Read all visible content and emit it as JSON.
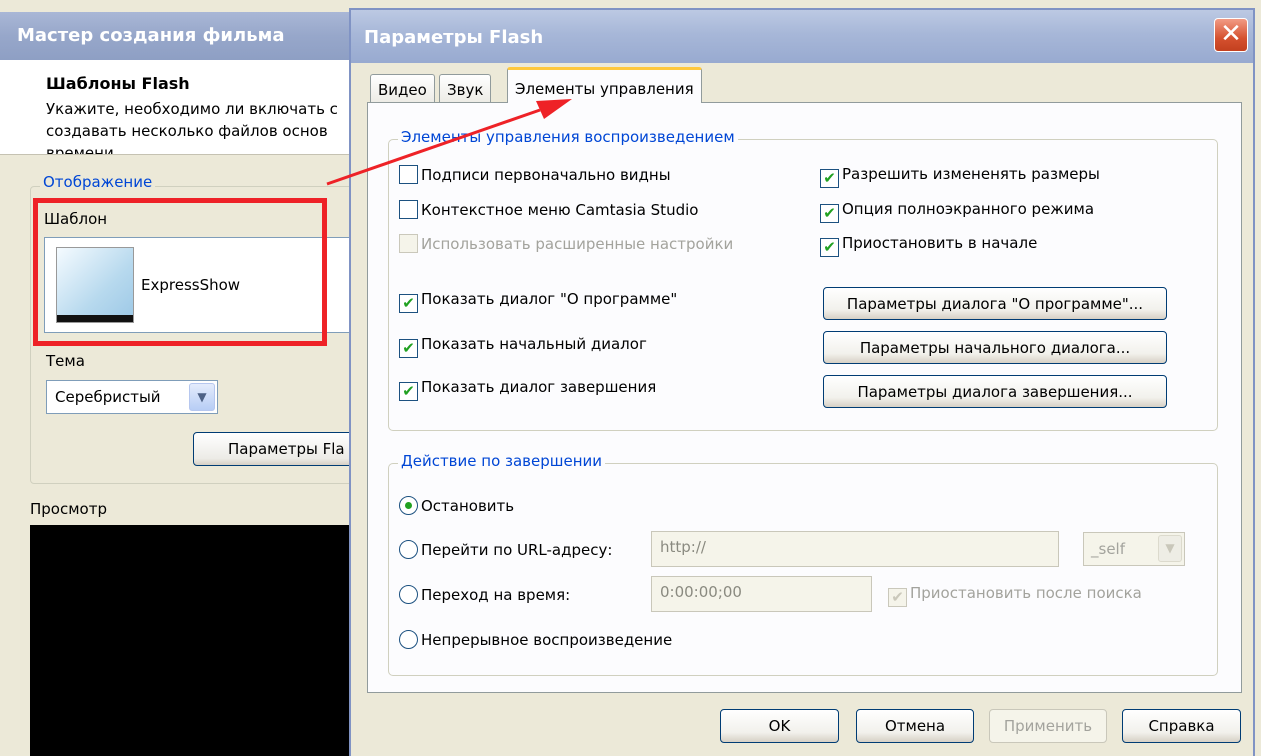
{
  "wizard": {
    "title": "Мастер создания фильма",
    "header_title": "Шаблоны Flash",
    "header_line1": "Укажите, необходимо ли включать с",
    "header_line2": "создавать несколько файлов основ",
    "header_line3": "времени.",
    "group_label": "Отображение",
    "template_label": "Шаблон",
    "template_name": "ExpressShow",
    "theme_label": "Тема",
    "theme_value": "Серебристый",
    "flash_params_button": "Параметры Fla",
    "preview_label": "Просмотр"
  },
  "dialog": {
    "title": "Параметры Flash",
    "close_glyph": "✕",
    "tabs": [
      {
        "label": "Видео",
        "active": false
      },
      {
        "label": "Звук",
        "active": false
      },
      {
        "label": "Элементы управления",
        "active": true
      }
    ],
    "playback_group": {
      "legend": "Элементы управления воспроизведением",
      "checkboxes": [
        {
          "label": "Подписи первоначально видны",
          "checked": false,
          "enabled": true
        },
        {
          "label": "Контекстное меню Camtasia Studio",
          "checked": false,
          "enabled": true
        },
        {
          "label": "Использовать расширенные настройки",
          "checked": false,
          "enabled": false
        },
        {
          "label": "Разрешить измененять размеры",
          "checked": true,
          "enabled": true
        },
        {
          "label": "Опция полноэкранного режима",
          "checked": true,
          "enabled": true
        },
        {
          "label": "Приостановить в начале",
          "checked": true,
          "enabled": true
        },
        {
          "label": "Показать диалог \"О программе\"",
          "checked": true,
          "enabled": true
        },
        {
          "label": "Показать начальный диалог",
          "checked": true,
          "enabled": true
        },
        {
          "label": "Показать диалог завершения",
          "checked": true,
          "enabled": true
        }
      ],
      "buttons": [
        "Параметры диалога \"О программе\"...",
        "Параметры начального диалога...",
        "Параметры диалога завершения..."
      ]
    },
    "end_group": {
      "legend": "Действие по завершении",
      "radios": [
        {
          "label": "Остановить",
          "selected": true
        },
        {
          "label": "Перейти по URL-адресу:",
          "selected": false
        },
        {
          "label": "Переход на время:",
          "selected": false
        },
        {
          "label": "Непрерывное воспроизведение",
          "selected": false
        }
      ],
      "url_value": "http://",
      "target_value": "_self",
      "time_value": "0:00:00;00",
      "pause_after_seek": "Приостановить после поиска"
    },
    "footer": {
      "ok": "OK",
      "cancel": "Отмена",
      "apply": "Применить",
      "help": "Справка"
    }
  },
  "colors": {
    "annotation_red": "#ee2227",
    "check_green": "#21a121",
    "legend_blue": "#0046d5"
  }
}
